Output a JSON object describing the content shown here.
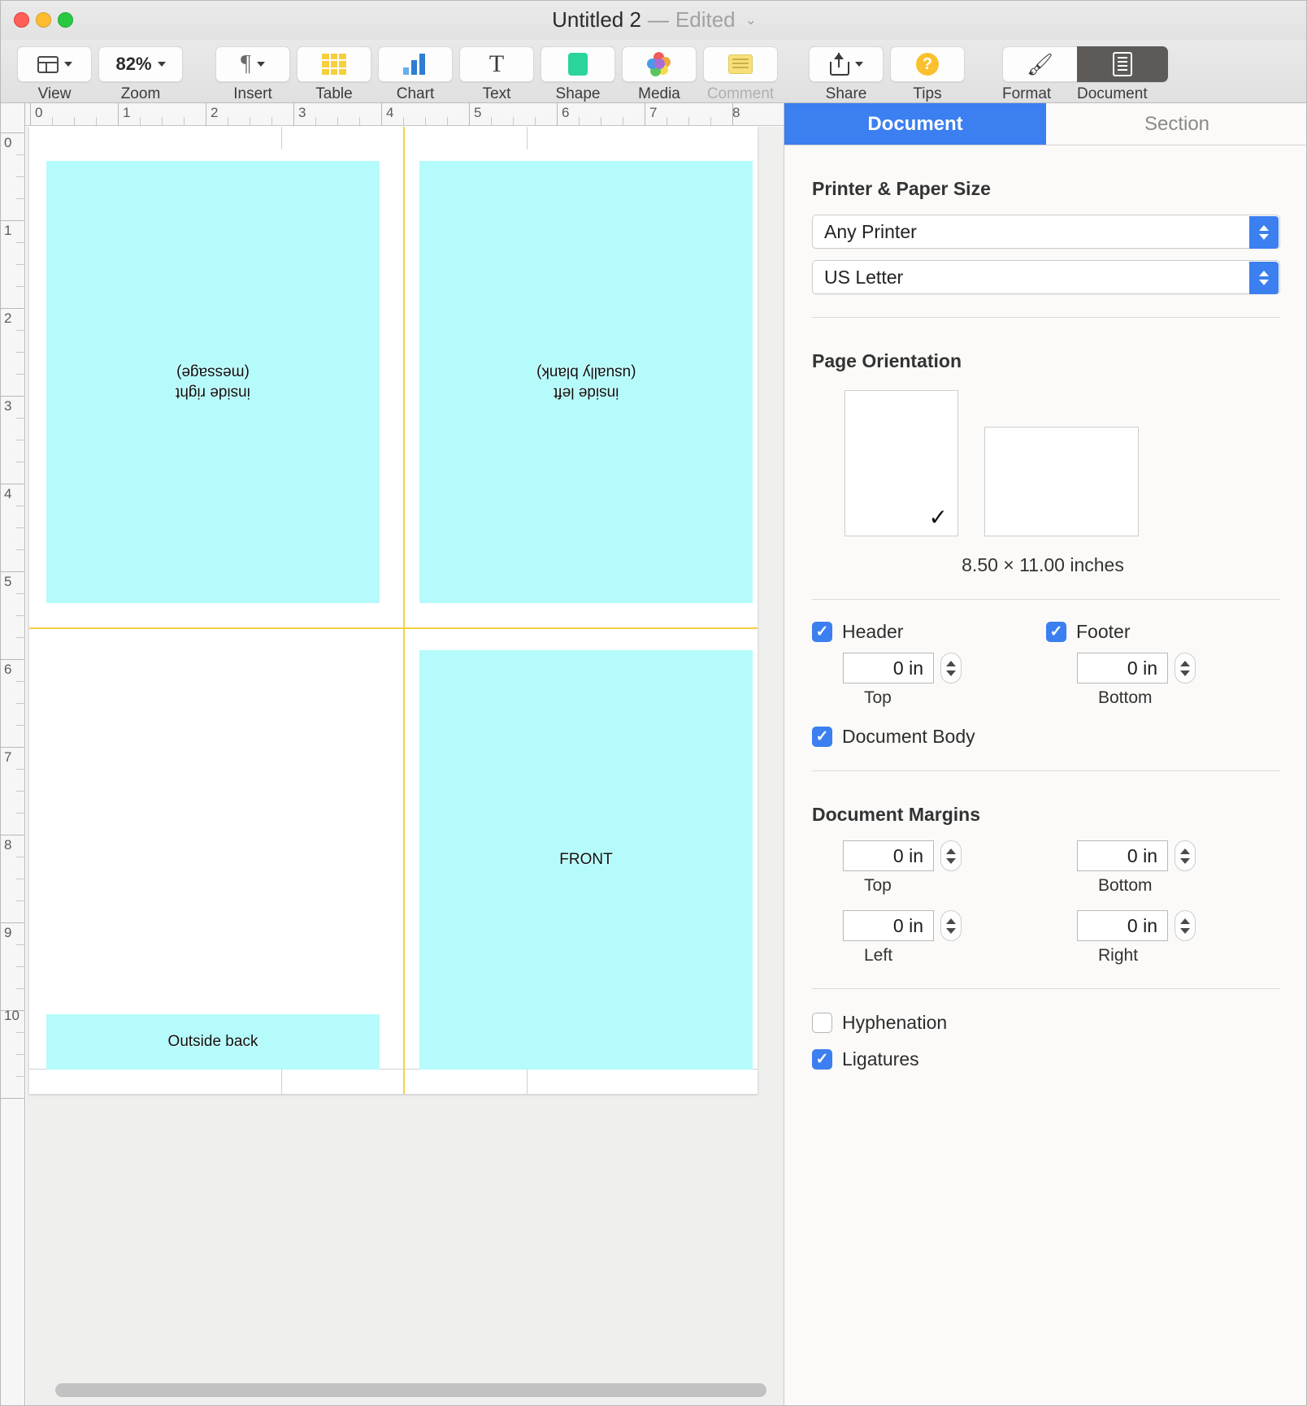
{
  "window": {
    "title": "Untitled 2",
    "dash": "—",
    "edited": "Edited",
    "traffic": {
      "close": "close-button",
      "minimize": "minimize-button",
      "zoom": "zoom-button"
    }
  },
  "toolbar": {
    "items": [
      {
        "label": "View",
        "icon": "view-icon",
        "has_chevron": true
      },
      {
        "label": "Zoom",
        "icon": "zoom-value",
        "value": "82%",
        "has_chevron": true
      },
      {
        "label": "Insert",
        "icon": "pilcrow-icon",
        "has_chevron": true
      },
      {
        "label": "Table",
        "icon": "table-icon",
        "has_chevron": false
      },
      {
        "label": "Chart",
        "icon": "chart-icon",
        "has_chevron": false
      },
      {
        "label": "Text",
        "icon": "text-icon",
        "has_chevron": false
      },
      {
        "label": "Shape",
        "icon": "shape-icon",
        "has_chevron": false
      },
      {
        "label": "Media",
        "icon": "media-icon",
        "has_chevron": false
      },
      {
        "label": "Comment",
        "icon": "comment-icon",
        "has_chevron": false,
        "disabled": true
      },
      {
        "label": "Share",
        "icon": "share-icon",
        "has_chevron": true
      },
      {
        "label": "Tips",
        "icon": "tips-icon",
        "has_chevron": false
      },
      {
        "label": "Format",
        "icon": "format-brush-icon",
        "has_chevron": false
      },
      {
        "label": "Document",
        "icon": "document-pane-icon",
        "has_chevron": false,
        "selected": true
      }
    ]
  },
  "rulers": {
    "horizontal_ticks": [
      "0",
      "1",
      "2",
      "3",
      "4",
      "5",
      "6",
      "7",
      "8"
    ],
    "vertical_ticks": [
      "0",
      "1",
      "2",
      "3",
      "4",
      "5",
      "6",
      "7",
      "8",
      "9",
      "10"
    ],
    "units": "inches"
  },
  "canvas": {
    "textboxes": [
      {
        "id": "inside-right",
        "text": "inside right\n(message)",
        "rotated": true
      },
      {
        "id": "inside-left",
        "text": "inside left\n(usually blank)",
        "rotated": true
      },
      {
        "id": "front",
        "text": "FRONT",
        "rotated": false
      },
      {
        "id": "outside-back",
        "text": "Outside back",
        "rotated": false
      }
    ],
    "guide_color": "#f5d040",
    "textbox_fill": "#b5fbfb"
  },
  "sidebar": {
    "tabs": [
      {
        "label": "Document",
        "active": true
      },
      {
        "label": "Section",
        "active": false
      }
    ],
    "printer_paper": {
      "heading": "Printer & Paper Size",
      "printer": "Any Printer",
      "paper": "US Letter"
    },
    "orientation": {
      "heading": "Page Orientation",
      "portrait_selected": true,
      "landscape_selected": false,
      "checkmark": "✓",
      "size_label": "8.50 × 11.00 inches"
    },
    "header_footer": {
      "header": {
        "label": "Header",
        "checked": true,
        "value": "0 in",
        "caption": "Top"
      },
      "footer": {
        "label": "Footer",
        "checked": true,
        "value": "0 in",
        "caption": "Bottom"
      },
      "body": {
        "label": "Document Body",
        "checked": true
      }
    },
    "margins": {
      "heading": "Document Margins",
      "top": {
        "value": "0 in",
        "caption": "Top"
      },
      "bottom": {
        "value": "0 in",
        "caption": "Bottom"
      },
      "left": {
        "value": "0 in",
        "caption": "Left"
      },
      "right": {
        "value": "0 in",
        "caption": "Right"
      }
    },
    "typography": {
      "hyphenation": {
        "label": "Hyphenation",
        "checked": false
      },
      "ligatures": {
        "label": "Ligatures",
        "checked": true
      }
    },
    "accent_color": "#3b7ff0"
  }
}
